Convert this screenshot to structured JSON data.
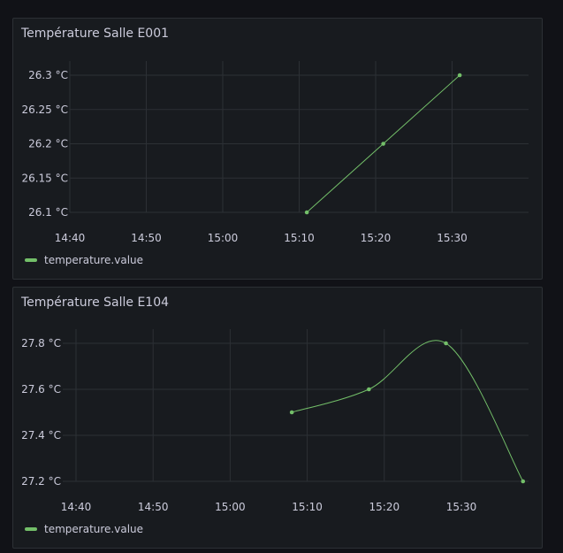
{
  "colors": {
    "background": "#111217",
    "panel": "#181b1f",
    "series": "#73bf69",
    "grid": "#2c3035",
    "text": "#ccccdc"
  },
  "panels": [
    {
      "title": "Température Salle E001",
      "legend": "temperature.value"
    },
    {
      "title": "Température Salle E104",
      "legend": "temperature.value"
    }
  ],
  "chart_data": [
    {
      "type": "line",
      "title": "Température Salle E001",
      "x_ticks": [
        "14:40",
        "14:50",
        "15:00",
        "15:10",
        "15:20",
        "15:30"
      ],
      "y_ticks": [
        "26.1 °C",
        "26.15 °C",
        "26.2 °C",
        "26.25 °C",
        "26.3 °C"
      ],
      "y_tick_values": [
        26.1,
        26.15,
        26.2,
        26.25,
        26.3
      ],
      "ylim": [
        26.1,
        26.3
      ],
      "xlim": [
        "14:40",
        "15:30"
      ],
      "grid": true,
      "legend_position": "bottom-left",
      "smooth": false,
      "series": [
        {
          "name": "temperature.value",
          "x": [
            "15:11",
            "15:21",
            "15:31"
          ],
          "y": [
            26.1,
            26.2,
            26.3
          ]
        }
      ]
    },
    {
      "type": "line",
      "title": "Température Salle E104",
      "x_ticks": [
        "14:40",
        "14:50",
        "15:00",
        "15:10",
        "15:20",
        "15:30"
      ],
      "y_ticks": [
        "27.2 °C",
        "27.4 °C",
        "27.6 °C",
        "27.8 °C"
      ],
      "y_tick_values": [
        27.2,
        27.4,
        27.6,
        27.8
      ],
      "ylim": [
        27.2,
        27.8
      ],
      "xlim": [
        "14:40",
        "15:30"
      ],
      "grid": true,
      "legend_position": "bottom-left",
      "smooth": true,
      "series": [
        {
          "name": "temperature.value",
          "x": [
            "15:08",
            "15:18",
            "15:28",
            "15:38"
          ],
          "y": [
            27.5,
            27.6,
            27.8,
            27.2
          ]
        }
      ]
    }
  ]
}
